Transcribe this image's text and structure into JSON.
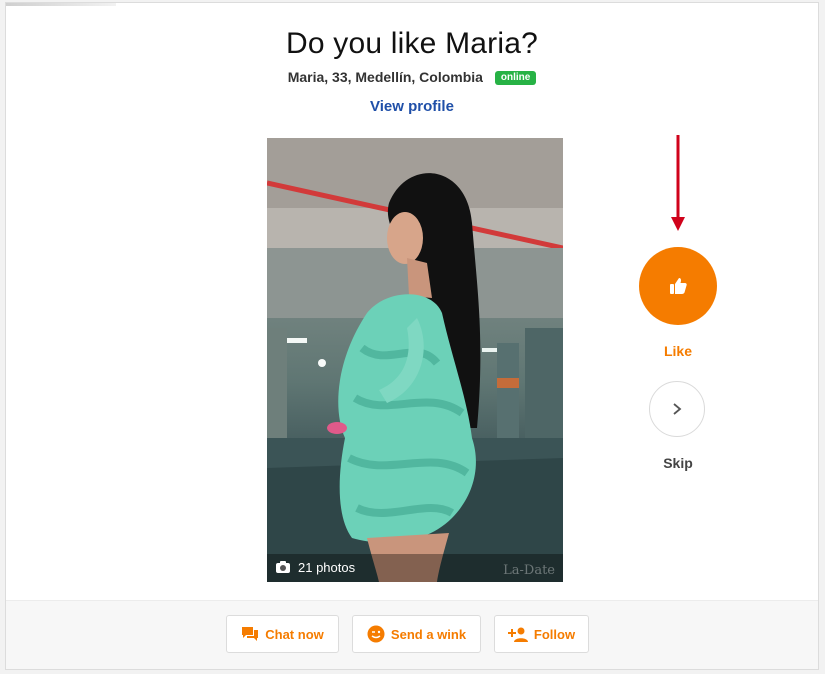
{
  "header": {
    "title": "Do you like Maria?",
    "details": "Maria, 33, Medellín, Colombia",
    "status_badge": "online",
    "view_profile": "View profile"
  },
  "photo": {
    "count_label": "21 photos",
    "watermark": "La-Date",
    "icon": "camera-icon"
  },
  "actions": {
    "like_label": "Like",
    "skip_label": "Skip",
    "like_icon": "thumbs-up-icon",
    "skip_icon": "chevron-right-icon"
  },
  "footer": {
    "chat_label": "Chat now",
    "wink_label": "Send a wink",
    "follow_label": "Follow"
  },
  "colors": {
    "accent": "#f57c00",
    "link": "#1f4fa8",
    "online": "#27b245",
    "arrow": "#d0021b"
  }
}
